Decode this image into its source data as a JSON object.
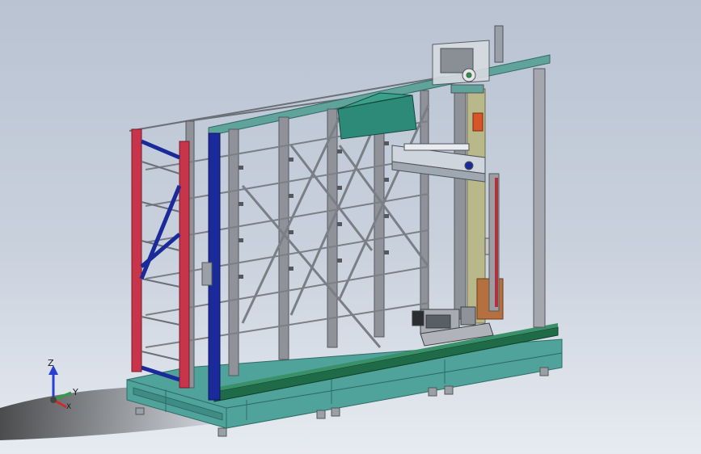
{
  "triad": {
    "z_label": "Z",
    "y_label": "Y",
    "x_label": "X"
  },
  "icons": {
    "triad": "coordinate-triad-icon"
  },
  "colors": {
    "background_top": "#b9c3d2",
    "background_bottom": "#e7ebf1",
    "frame_grey": "#8f9298",
    "red_column": "#c8354a",
    "blue_column": "#1b2a9a",
    "base_teal": "#4fa39a",
    "rail_green": "#1f6b47",
    "box_teal": "#2e8a78"
  }
}
